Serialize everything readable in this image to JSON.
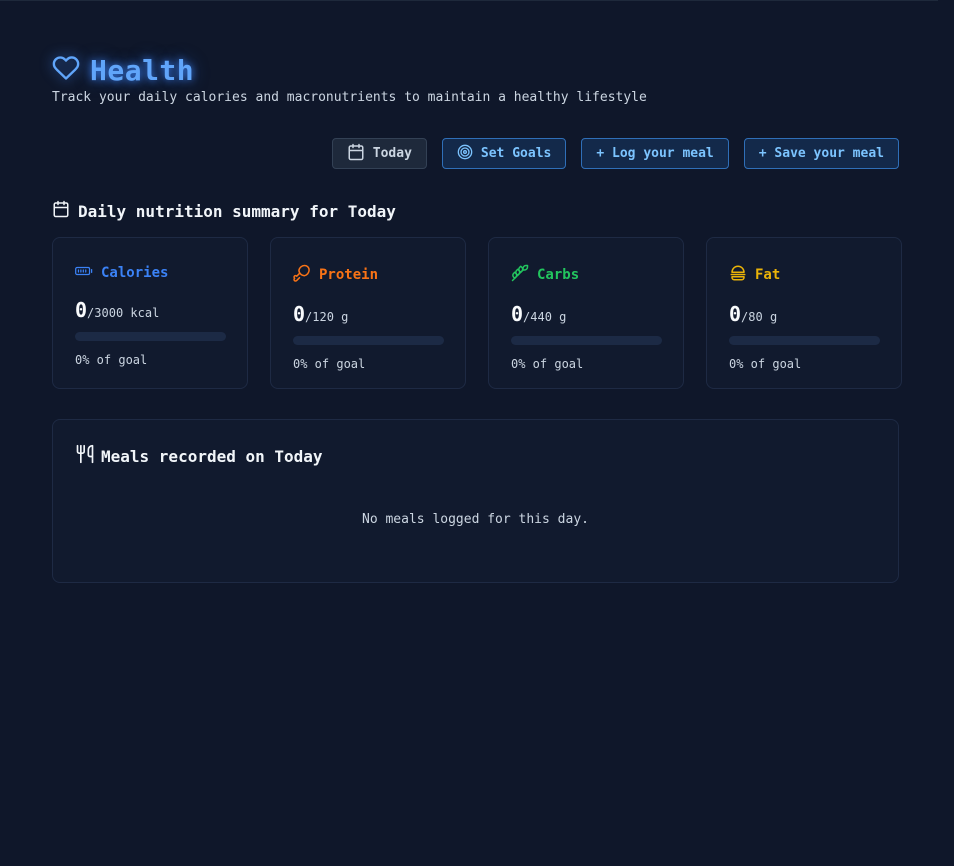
{
  "header": {
    "title": "Health",
    "subtitle": "Track your daily calories and macronutrients to maintain a healthy lifestyle",
    "icon": "heart-icon",
    "accent_color": "#60a5fa"
  },
  "toolbar": {
    "date_label": "Today",
    "set_goals_label": "Set Goals",
    "log_meal_label": "+ Log your meal",
    "save_meal_label": "+ Save your meal"
  },
  "summary": {
    "title": "Daily nutrition summary for Today",
    "icon": "calendar-icon"
  },
  "cards": [
    {
      "name": "Calories",
      "icon": "battery-icon",
      "color": "#3b82f6",
      "value": "0",
      "goal": "/3000 kcal",
      "progress": 0,
      "percent_label": "0% of goal"
    },
    {
      "name": "Protein",
      "icon": "drumstick-icon",
      "color": "#f97316",
      "value": "0",
      "goal": "/120 g",
      "progress": 0,
      "percent_label": "0% of goal"
    },
    {
      "name": "Carbs",
      "icon": "wheat-icon",
      "color": "#22c55e",
      "value": "0",
      "goal": "/440 g",
      "progress": 0,
      "percent_label": "0% of goal"
    },
    {
      "name": "Fat",
      "icon": "burger-icon",
      "color": "#eab308",
      "value": "0",
      "goal": "/80 g",
      "progress": 0,
      "percent_label": "0% of goal"
    }
  ],
  "meals": {
    "title": "Meals recorded on Today",
    "icon": "utensils-icon",
    "empty_text": "No meals logged for this day."
  }
}
